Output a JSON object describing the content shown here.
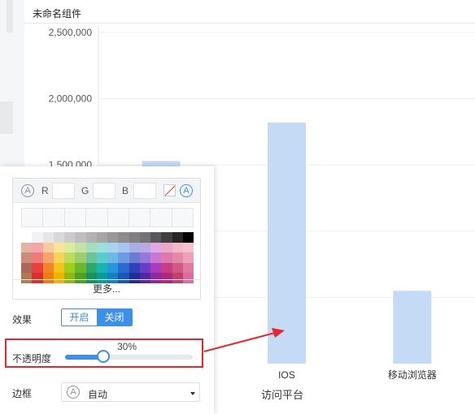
{
  "widget": {
    "title": "未命名组件"
  },
  "chart_data": {
    "type": "bar",
    "xlabel": "访问平台",
    "ylabel": "",
    "categories": [
      "",
      "IOS",
      "移动浏览器"
    ],
    "values": [
      1530000,
      1820000,
      550000
    ],
    "ylim": [
      0,
      2500000
    ],
    "yticks": [
      2500000,
      2000000,
      1500000
    ],
    "ytick_labels": [
      "2,500,000",
      "2,000,000",
      "1,500,000"
    ],
    "bar_color": "#c4daf5",
    "grid": true
  },
  "panel": {
    "rgb": {
      "r_label": "R",
      "g_label": "G",
      "b_label": "B",
      "auto_symbol": "A"
    },
    "more_label": "更多...",
    "effect": {
      "label": "效果",
      "on_label": "开启",
      "off_label": "关闭",
      "selected": "关闭"
    },
    "opacity": {
      "label": "不透明度",
      "value_text": "30%",
      "value": 0.3
    },
    "border": {
      "label": "边框",
      "value": "自动",
      "auto_symbol": "A"
    },
    "palette": [
      "#ffffff",
      "#f2f2f2",
      "#e6e6e6",
      "#d9d9d9",
      "#cccccc",
      "#bfbfbf",
      "#b3b3b3",
      "#a6a6a6",
      "#999999",
      "#8c8c8c",
      "#808080",
      "#737373",
      "#595959",
      "#404040",
      "#262626",
      "#000000",
      "#e3b3a6",
      "#f4a7a7",
      "#f9c9a0",
      "#fbe49a",
      "#d9ec9e",
      "#c2e3a4",
      "#a7dcc1",
      "#9fdede",
      "#a7d4ee",
      "#a9c4ee",
      "#a8b0e3",
      "#bda8e6",
      "#dda8e3",
      "#eba8cb",
      "#f0b8c8",
      "#f7c0d0",
      "#cc8c78",
      "#ee7b7b",
      "#f6a56a",
      "#f8d35a",
      "#bedc5c",
      "#9ccf6c",
      "#6cc49a",
      "#5ccbcb",
      "#6cb9e4",
      "#6e9ae4",
      "#6c7ad4",
      "#9579d8",
      "#c579d4",
      "#dd79ac",
      "#e48aa8",
      "#eda0b8",
      "#a86a55",
      "#e84040",
      "#f2852a",
      "#f5c41c",
      "#a2cc1a",
      "#6bb830",
      "#2ea86a",
      "#18b4b4",
      "#2896d8",
      "#2c6ad2",
      "#3040b8",
      "#6a3ec4",
      "#a83cbc",
      "#c83c8a",
      "#d05a86",
      "#e07aa0",
      "#b07a50",
      "#d63030",
      "#ee7a10",
      "#f0b400",
      "#90b810",
      "#50a020",
      "#16925a",
      "#0a9a9a",
      "#1480c8",
      "#1856b8",
      "#202c9a",
      "#5426a8",
      "#8e2aa0",
      "#b0287a",
      "#c0406e",
      "#e06aa0"
    ]
  }
}
